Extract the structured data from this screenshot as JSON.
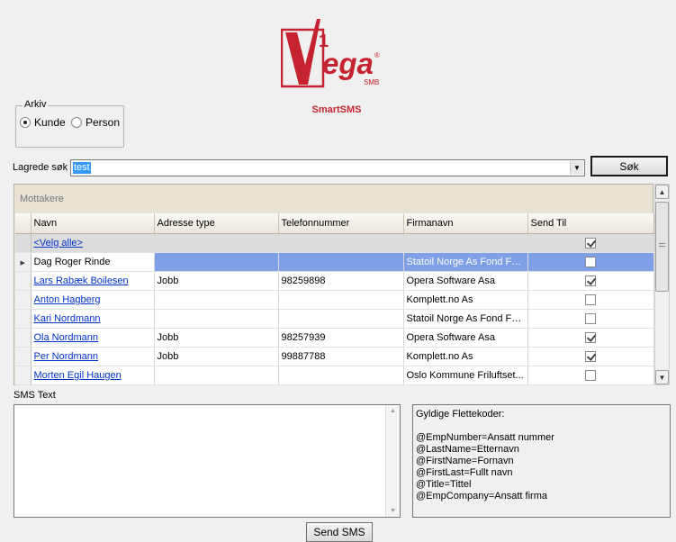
{
  "logo": {
    "text": "Vega",
    "superscript": "1",
    "sub": "SMB",
    "registered": "®"
  },
  "app_title": "SmartSMS",
  "arkiv": {
    "legend": "Arkiv",
    "options": [
      {
        "label": "Kunde",
        "selected": true
      },
      {
        "label": "Person",
        "selected": false
      }
    ]
  },
  "search": {
    "label": "Lagrede søk",
    "value": "test",
    "button": "Søk"
  },
  "grid": {
    "caption": "Mottakere",
    "columns": [
      "Navn",
      "Adresse type",
      "Telefonnummer",
      "Firmanavn",
      "Send Til"
    ],
    "rows": [
      {
        "navn": "<Velg alle>",
        "adresse": "",
        "telefon": "",
        "firma": "",
        "send": true
      },
      {
        "navn": "Dag Roger Rinde",
        "adresse": "",
        "telefon": "",
        "firma": "Statoil Norge As Fond Fo...",
        "send": false
      },
      {
        "navn": "Lars Rabæk Boilesen",
        "adresse": "Jobb",
        "telefon": "98259898",
        "firma": "Opera Software Asa",
        "send": true
      },
      {
        "navn": "Anton Hagberg",
        "adresse": "",
        "telefon": "",
        "firma": "Komplett.no As",
        "send": false
      },
      {
        "navn": "Kari Nordmann",
        "adresse": "",
        "telefon": "",
        "firma": "Statoil Norge As Fond Fo...",
        "send": false
      },
      {
        "navn": "Ola Nordmann",
        "adresse": "Jobb",
        "telefon": "98257939",
        "firma": "Opera Software Asa",
        "send": true
      },
      {
        "navn": "Per Nordmann",
        "adresse": "Jobb",
        "telefon": "99887788",
        "firma": "Komplett.no As",
        "send": true
      },
      {
        "navn": "Morten Egil Haugen",
        "adresse": "",
        "telefon": "",
        "firma": "Oslo Kommune Friluftset...",
        "send": false
      }
    ]
  },
  "sms": {
    "label": "SMS Text",
    "value": "",
    "merge_title": "Gyldige Flettekoder:",
    "merge_codes": [
      "@EmpNumber=Ansatt nummer",
      "@LastName=Etternavn",
      "@FirstName=Fornavn",
      "@FirstLast=Fullt navn",
      "@Title=Tittel",
      "@EmpCompany=Ansatt firma"
    ],
    "send_button": "Send SMS"
  },
  "colors": {
    "brand_red": "#c4232f",
    "selection_blue": "#7f9fe6",
    "link_blue": "#0033cc"
  }
}
